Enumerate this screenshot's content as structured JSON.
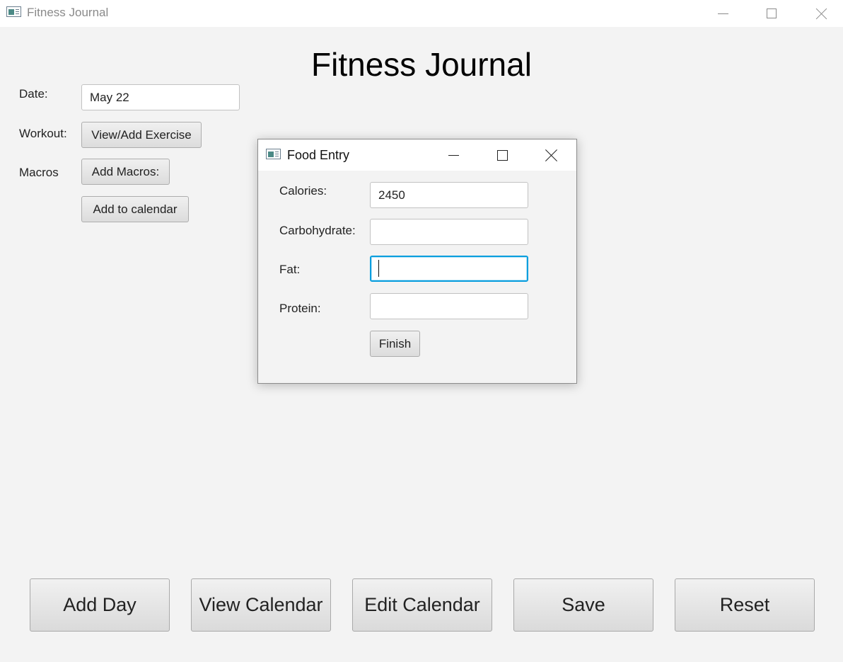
{
  "window": {
    "title": "Fitness Journal"
  },
  "main": {
    "heading": "Fitness Journal",
    "date_label": "Date:",
    "date_value": "May 22",
    "workout_label": "Workout:",
    "view_add_exercise": "View/Add Exercise",
    "macros_label": "Macros",
    "add_macros": "Add Macros:",
    "add_to_calendar": "Add to calendar"
  },
  "bottom_bar": {
    "add_day": "Add Day",
    "view_calendar": "View Calendar",
    "edit_calendar": "Edit Calendar",
    "save": "Save",
    "reset": "Reset"
  },
  "dialog": {
    "title": "Food Entry",
    "calories_label": "Calories:",
    "calories_value": "2450",
    "carbohydrate_label": "Carbohydrate:",
    "carbohydrate_value": "",
    "fat_label": "Fat:",
    "fat_value": "",
    "protein_label": "Protein:",
    "protein_value": "",
    "finish": "Finish"
  },
  "icons": {
    "app": "app-window-icon",
    "minimize": "minimize-icon",
    "maximize": "maximize-icon",
    "close": "close-icon"
  },
  "colors": {
    "focus_border": "#0a9ede",
    "background": "#f3f3f3"
  }
}
